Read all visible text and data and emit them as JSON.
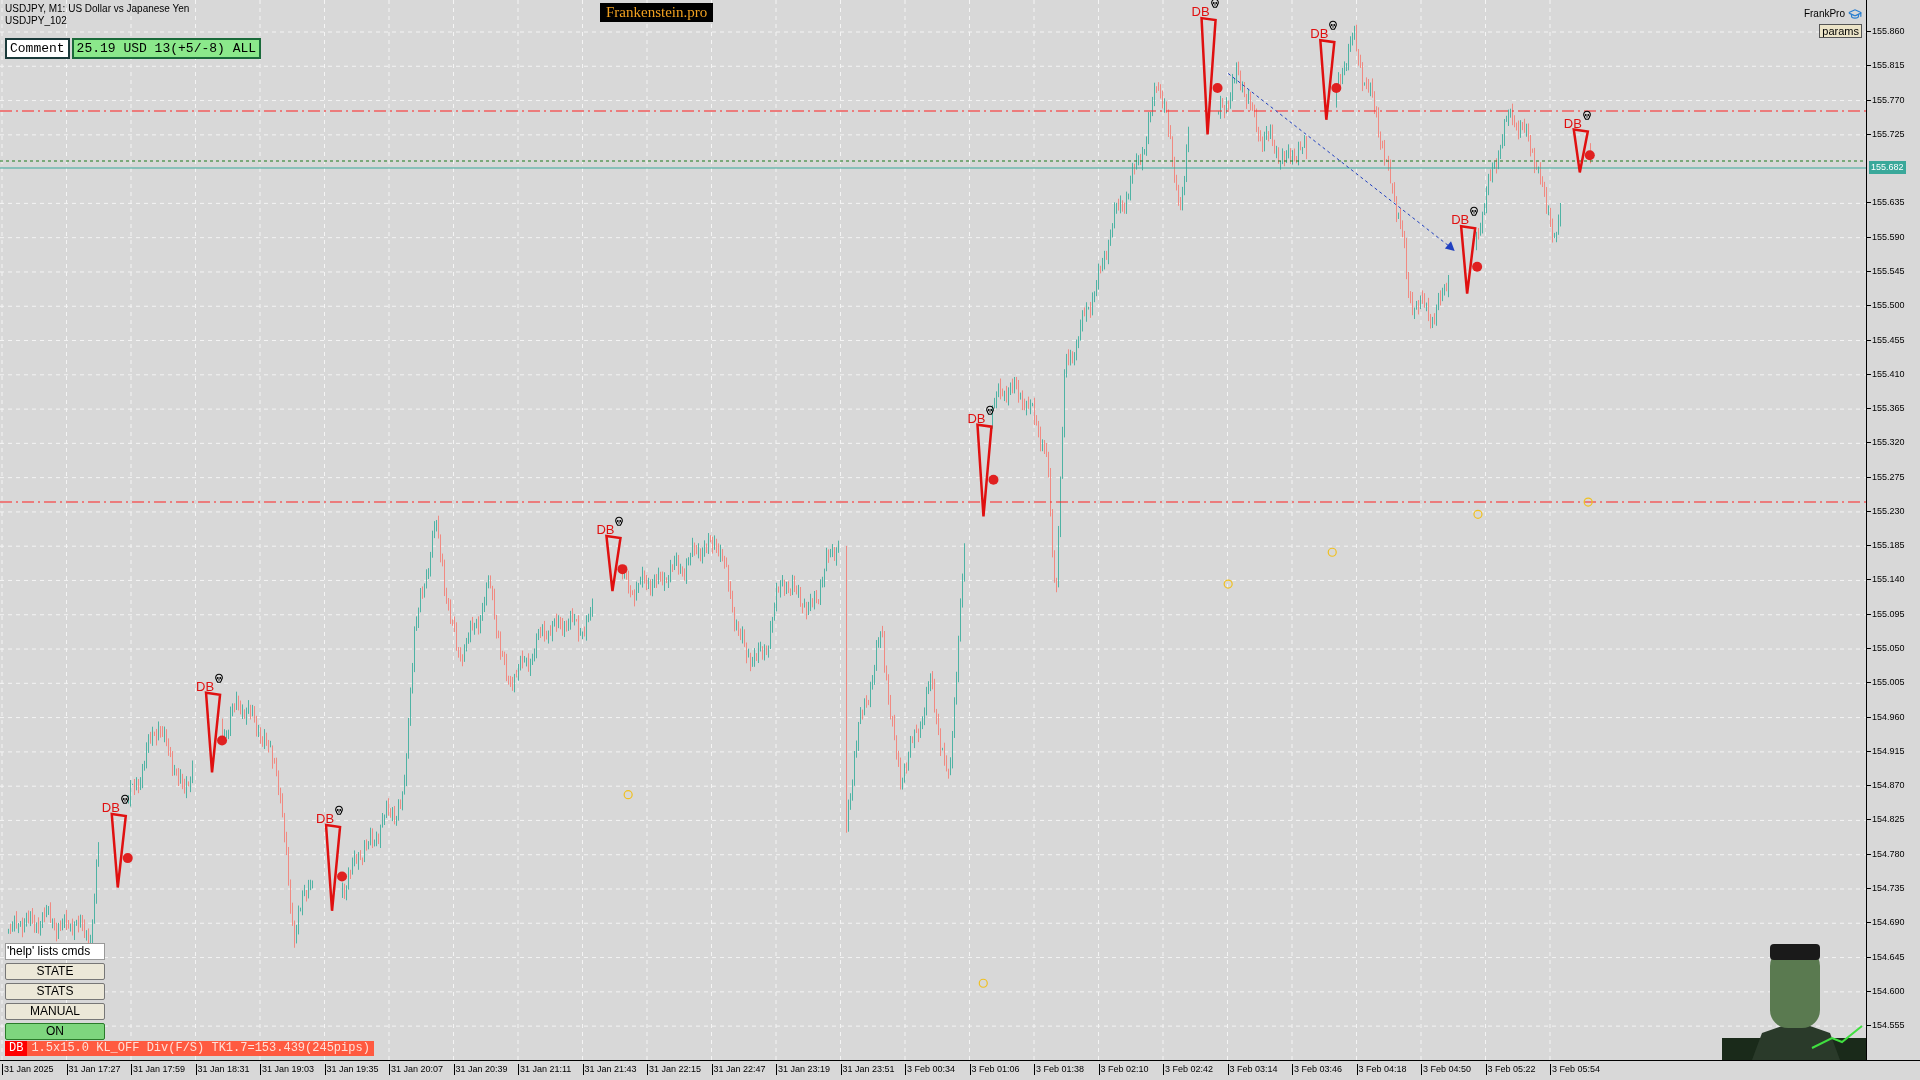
{
  "window": {
    "symbol_line": "USDJPY, M1:  US Dollar vs Japanese Yen",
    "account": "USDJPY_102"
  },
  "brand": {
    "text": "Frankenstein.pro"
  },
  "comment": {
    "label": "Comment",
    "value": "25.19 USD 13(+5/-8) ALL"
  },
  "top_right": {
    "name": "FrankPro",
    "params_button": "params"
  },
  "price_axis": {
    "ticks": [
      "155.860",
      "155.815",
      "155.770",
      "155.725",
      "155.635",
      "155.590",
      "155.545",
      "155.500",
      "155.455",
      "155.410",
      "155.365",
      "155.320",
      "155.275",
      "155.230",
      "155.185",
      "155.140",
      "155.095",
      "155.050",
      "155.005",
      "154.960",
      "154.915",
      "154.870",
      "154.825",
      "154.780",
      "154.735",
      "154.690",
      "154.645",
      "154.600",
      "154.555"
    ],
    "current_price": "155.682"
  },
  "time_axis": {
    "labels": [
      "31 Jan 2025",
      "31 Jan 17:27",
      "31 Jan 17:59",
      "31 Jan 18:31",
      "31 Jan 19:03",
      "31 Jan 19:35",
      "31 Jan 20:07",
      "31 Jan 20:39",
      "31 Jan 21:11",
      "31 Jan 21:43",
      "31 Jan 22:15",
      "31 Jan 22:47",
      "31 Jan 23:19",
      "31 Jan 23:51",
      "3 Feb 00:34",
      "3 Feb 01:06",
      "3 Feb 01:38",
      "3 Feb 02:10",
      "3 Feb 02:42",
      "3 Feb 03:14",
      "3 Feb 03:46",
      "3 Feb 04:18",
      "3 Feb 04:50",
      "3 Feb 05:22",
      "3 Feb 05:54"
    ]
  },
  "patterns": [
    {
      "label": "DB"
    },
    {
      "label": "DB"
    },
    {
      "label": "DB"
    },
    {
      "label": "DB"
    },
    {
      "label": "DB"
    },
    {
      "label": "DB"
    },
    {
      "label": "DB"
    },
    {
      "label": "DB"
    },
    {
      "label": "DB"
    }
  ],
  "panel": {
    "help_field": {
      "value": "'help' lists cmds"
    },
    "buttons": [
      {
        "label": "STATE",
        "active": false
      },
      {
        "label": "STATS",
        "active": false
      },
      {
        "label": "MANUAL",
        "active": false
      },
      {
        "label": "ON",
        "active": true
      }
    ]
  },
  "status_bar": {
    "tag": "DB",
    "text": "1.5x15.0 KL_OFF Div(F/S) TK1.7=153.439(245pips)"
  }
}
